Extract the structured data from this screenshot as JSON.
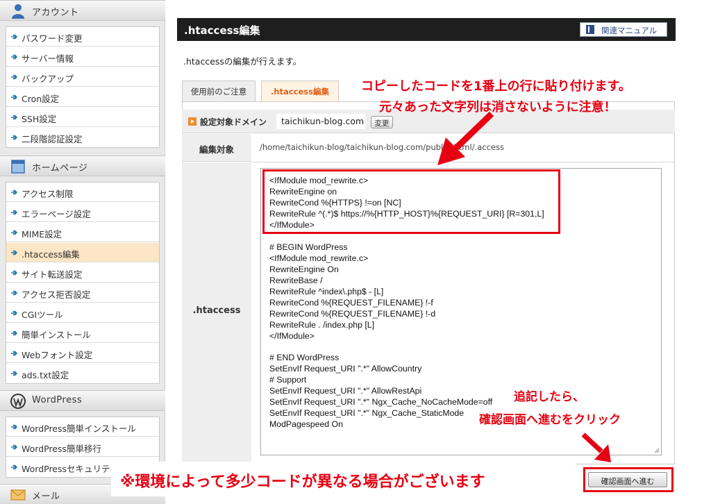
{
  "sidebar": {
    "sections": [
      {
        "label": "アカウント",
        "icon": "user-icon",
        "items": [
          "パスワード変更",
          "サーバー情報",
          "バックアップ",
          "Cron設定",
          "SSH設定",
          "二段階認証設定"
        ]
      },
      {
        "label": "ホームページ",
        "icon": "homepage-icon",
        "items": [
          "アクセス制限",
          "エラーページ設定",
          "MIME設定",
          ".htaccess編集",
          "サイト転送設定",
          "アクセス拒否設定",
          "CGIツール",
          "簡単インストール",
          "Webフォント設定",
          "ads.txt設定"
        ]
      },
      {
        "label": "WordPress",
        "icon": "wordpress-icon",
        "items": [
          "WordPress簡単インストール",
          "WordPress簡単移行",
          "WordPressセキュリティ設定"
        ]
      },
      {
        "label": "メール",
        "icon": "mail-icon",
        "items": []
      }
    ],
    "active_item": ".htaccess編集"
  },
  "header": {
    "title": ".htaccess編集",
    "manual_button": "関連マニュアル"
  },
  "intro": ".htaccessの編集が行えます。",
  "tabs": [
    {
      "label": "使用前のご注意",
      "active": false
    },
    {
      "label": ".htaccess編集",
      "active": true
    }
  ],
  "domain": {
    "label": "設定対象ドメイン",
    "value": "taichikun-blog.com",
    "change_button": "変更"
  },
  "target": {
    "label": "編集対象",
    "path": "/home/taichikun-blog/taichikun-blog.com/public_html/.access"
  },
  "editor": {
    "label": ".htaccess",
    "lines": [
      "<IfModule mod_rewrite.c>",
      "RewriteEngine on",
      "RewriteCond %{HTTPS} !=on [NC]",
      "RewriteRule ^(.*)$ https://%{HTTP_HOST}%{REQUEST_URI} [R=301,L]",
      "</IfModule>",
      "",
      "# BEGIN WordPress",
      "<IfModule mod_rewrite.c>",
      "RewriteEngine On",
      "RewriteBase /",
      "RewriteRule ^index\\.php$ - [L]",
      "RewriteCond %{REQUEST_FILENAME} !-f",
      "RewriteCond %{REQUEST_FILENAME} !-d",
      "RewriteRule . /index.php [L]",
      "</IfModule>",
      "",
      "# END WordPress",
      "SetEnvIf Request_URI \".*\" AllowCountry",
      "# Support",
      "SetEnvIf Request_URI \".*\" AllowRestApi",
      "SetEnvIf Request_URI \".*\" Ngx_Cache_NoCacheMode=off",
      "SetEnvIf Request_URI \".*\" Ngx_Cache_StaticMode",
      "ModPagespeed On"
    ]
  },
  "confirm_button": "確認画面へ進む",
  "annotations": {
    "note1": "コピーしたコードを1番上の行に貼り付けます。",
    "note2": "元々あった文字列は消さないように注意！",
    "note3": "追記したら、",
    "note4": "確認画面へ進むをクリック",
    "note5": "※環境によって多少コードが異なる場合がございます"
  },
  "colors": {
    "accent_red": "#e60012",
    "active_tab_text": "#e2611b",
    "active_nav_bg": "#fbe6c5",
    "title_bar": "#1e1e1e"
  }
}
